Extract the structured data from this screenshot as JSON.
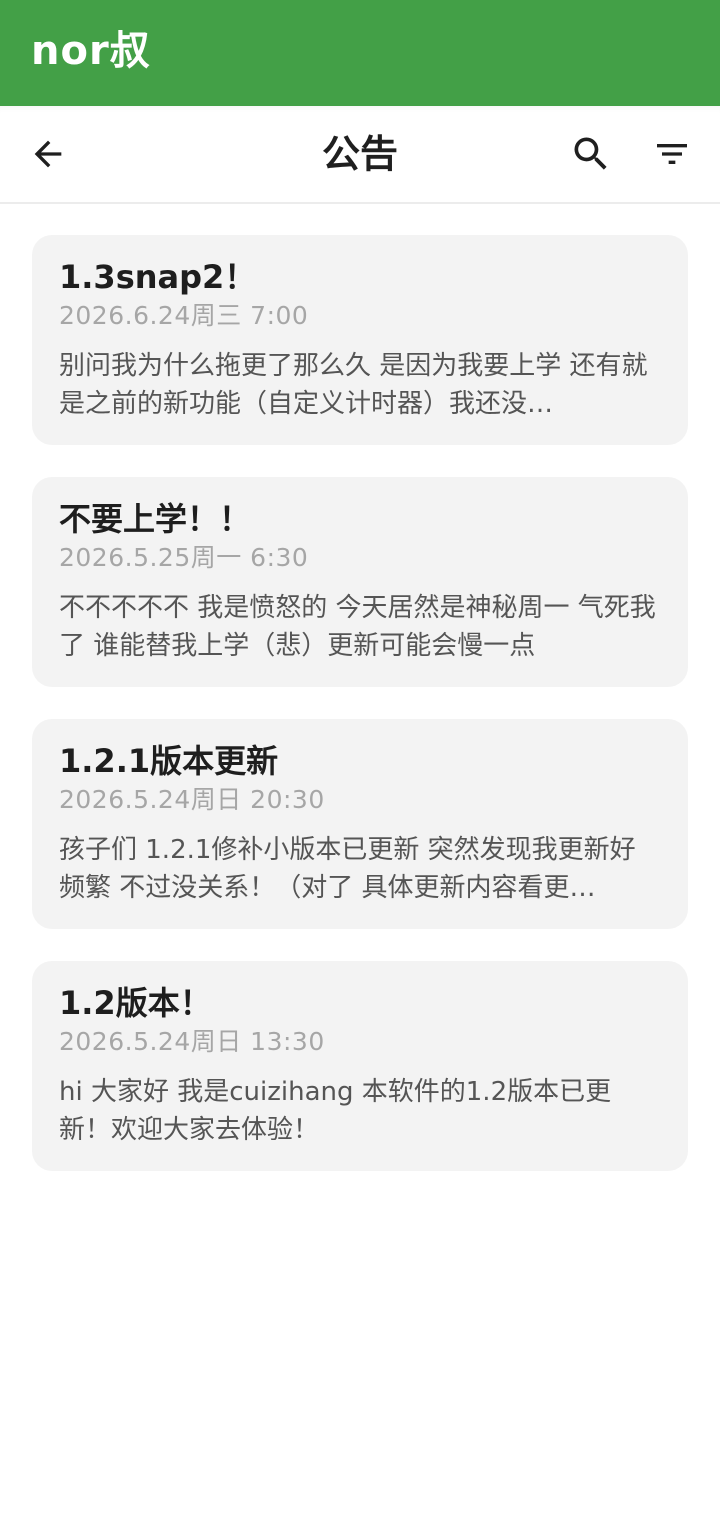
{
  "app": {
    "title": "nor叔",
    "accent_color": "#43a047"
  },
  "toolbar": {
    "back_icon": "arrow-left-icon",
    "title": "公告",
    "search_icon": "search-icon",
    "filter_icon": "filter-icon"
  },
  "announcements": [
    {
      "title": "1.3snap2！",
      "date": "2026.6.24周三 7:00",
      "body": "别问我为什么拖更了那么久 是因为我要上学 还有就是之前的新功能（自定义计时器）我还没…"
    },
    {
      "title": "不要上学！！",
      "date": "2026.5.25周一 6:30",
      "body": "不不不不不 我是愤怒的 今天居然是神秘周一 气死我了 谁能替我上学（悲）更新可能会慢一点"
    },
    {
      "title": "1.2.1版本更新",
      "date": "2026.5.24周日 20:30",
      "body": "孩子们 1.2.1修补小版本已更新 突然发现我更新好频繁 不过没关系！（对了 具体更新内容看更…"
    },
    {
      "title": "1.2版本！",
      "date": "2026.5.24周日 13:30",
      "body": "hi 大家好 我是cuizihang 本软件的1.2版本已更新！欢迎大家去体验！"
    }
  ]
}
